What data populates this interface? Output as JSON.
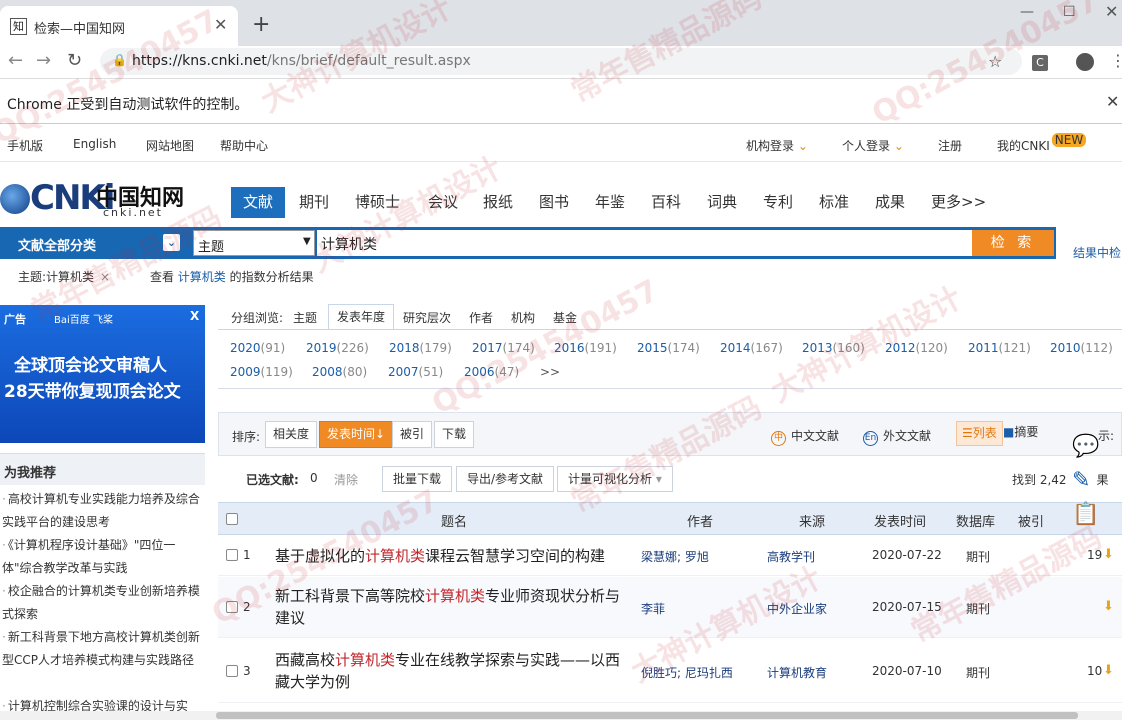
{
  "browser": {
    "tab_title": "检索—中国知网",
    "favicon_text": "知",
    "url_host": "https://kns.cnki.net",
    "url_path": "/kns/brief/default_result.aspx",
    "infobar": "Chrome 正受到自动测试软件的控制。",
    "ext_label": "C"
  },
  "toplinks": {
    "mobile": "手机版",
    "english": "English",
    "sitemap": "网站地图",
    "help": "帮助中心",
    "inst_login": "机构登录",
    "personal_login": "个人登录",
    "register": "注册",
    "my_cnki": "我的CNKI",
    "new_badge": "NEW"
  },
  "logo": {
    "cnki": "CNKi",
    "cn": "中国知网",
    "net": "cnki.net"
  },
  "nav": [
    "文献",
    "期刊",
    "博硕士",
    "会议",
    "报纸",
    "图书",
    "年鉴",
    "百科",
    "词典",
    "专利",
    "标准",
    "成果",
    "更多>>"
  ],
  "search": {
    "category": "文献全部分类",
    "field": "主题",
    "query": "计算机类",
    "button": "检 索",
    "search_in_results": "结果中检"
  },
  "subject_tag": {
    "label": "主题:计算机类",
    "remove": "×",
    "view_prefix": "查看",
    "view_hl": "计算机类",
    "view_suffix": "的指数分析结果"
  },
  "ad": {
    "tag": "广告",
    "brand": "Bai百度  飞桨",
    "close": "X",
    "line1": "全球顶会论文审稿人",
    "line2": "28天带你复现顶会论文"
  },
  "recommend": {
    "title": "为我推荐",
    "items": [
      "高校计算机专业实践能力培养及综合实践平台的建设思考",
      "《计算机程序设计基础》\"四位一体\"综合教学改革与实践",
      "校企融合的计算机类专业创新培养模式探索",
      "新工科背景下地方高校计算机类创新型CCP人才培养模式构建与实践路径",
      "计算机控制综合实验课的设计与实"
    ]
  },
  "group": {
    "label": "分组浏览:",
    "tabs": [
      "主题",
      "发表年度",
      "研究层次",
      "作者",
      "机构",
      "基金"
    ],
    "years": [
      {
        "y": "2020",
        "c": "(91)"
      },
      {
        "y": "2019",
        "c": "(226)"
      },
      {
        "y": "2018",
        "c": "(179)"
      },
      {
        "y": "2017",
        "c": "(174)"
      },
      {
        "y": "2016",
        "c": "(191)"
      },
      {
        "y": "2015",
        "c": "(174)"
      },
      {
        "y": "2014",
        "c": "(167)"
      },
      {
        "y": "2013",
        "c": "(160)"
      },
      {
        "y": "2012",
        "c": "(120)"
      },
      {
        "y": "2011",
        "c": "(121)"
      },
      {
        "y": "2010",
        "c": "(112)"
      },
      {
        "y": "2009",
        "c": "(119)"
      },
      {
        "y": "2008",
        "c": "(80)"
      },
      {
        "y": "2007",
        "c": "(51)"
      },
      {
        "y": "2006",
        "c": "(47)"
      }
    ],
    "more": ">>"
  },
  "sort": {
    "label": "排序:",
    "options": [
      "相关度",
      "发表时间",
      "被引",
      "下载"
    ],
    "active": "发表时间",
    "zh": "中文文献",
    "en": "外文文献",
    "zh_icon": "中",
    "en_icon": "En",
    "list": "列表",
    "abstract": "摘要",
    "display_partial": "示:"
  },
  "selected": {
    "label": "已选文献:",
    "count": "0",
    "clear": "清除",
    "batch_download": "批量下载",
    "export": "导出/参考文献",
    "visual": "计量可视化分析",
    "found": "找到 2,42",
    "found_suffix": "果"
  },
  "table": {
    "headers": [
      "题名",
      "作者",
      "来源",
      "发表时间",
      "数据库",
      "被引"
    ],
    "rows": [
      {
        "num": "1",
        "t1": "基于虚拟化的",
        "hl": "计算机类",
        "t2": "课程云智慧学习空间的构建",
        "author": "梁慧娜; 罗旭",
        "source": "高教学刊",
        "date": "2020-07-22",
        "db": "期刊",
        "cite": "19"
      },
      {
        "num": "2",
        "t1": "新工科背景下高等院校",
        "hl": "计算机类",
        "t2": "专业师资现状分析与建议",
        "author": "李菲",
        "source": "中外企业家",
        "date": "2020-07-15",
        "db": "期刊",
        "cite": ""
      },
      {
        "num": "3",
        "t1": "西藏高校",
        "hl": "计算机类",
        "t2": "专业在线教学探索与实践——以西藏大学为例",
        "author": "倪胜巧; 尼玛扎西",
        "source": "计算机教育",
        "date": "2020-07-10",
        "db": "期刊",
        "cite": "10"
      }
    ]
  },
  "watermarks": [
    "QQ:254540457",
    "大神计算机设计",
    "常年售精品源码",
    "QQ:254540457",
    "大神计算机设计",
    "常年售精品源码",
    "QQ:254540457",
    "大神计算机设计",
    "常年售精品源码",
    "QQ:254540457",
    "大神计算机设计",
    "常年售精品源码"
  ]
}
